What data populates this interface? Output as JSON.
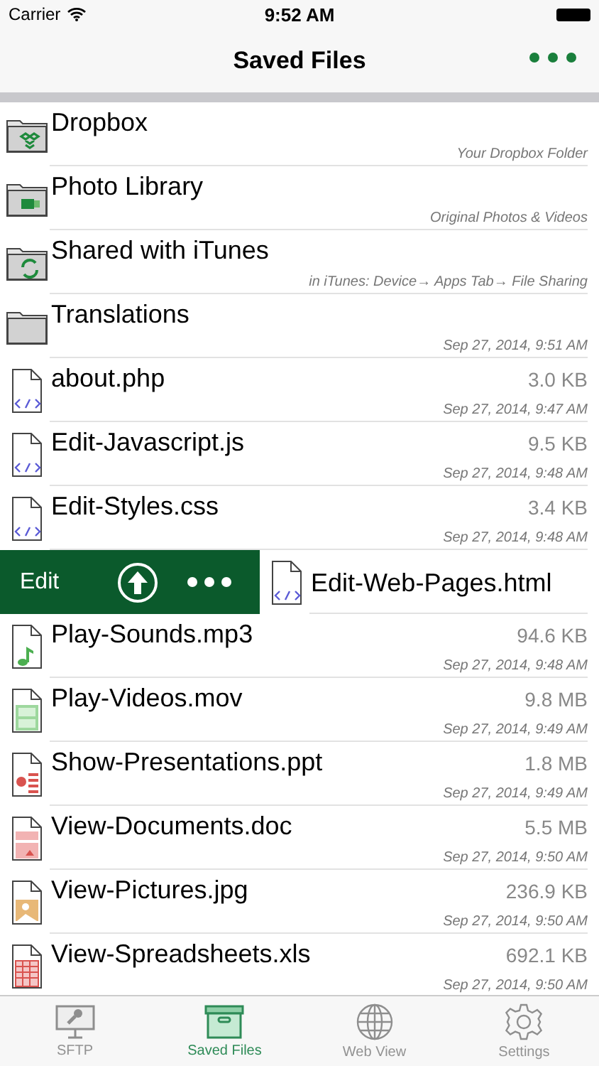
{
  "status_bar": {
    "carrier": "Carrier",
    "time": "9:52 AM"
  },
  "nav": {
    "title": "Saved Files"
  },
  "rows": [
    {
      "kind": "dropbox",
      "name": "Dropbox",
      "subtitle": "Your Dropbox Folder"
    },
    {
      "kind": "photo",
      "name": "Photo Library",
      "subtitle": "Original Photos & Videos"
    },
    {
      "kind": "sync",
      "name": "Shared with iTunes",
      "subtitle": "in iTunes: Device→ Apps Tab→ File Sharing"
    },
    {
      "kind": "folder",
      "name": "Translations",
      "subtitle": "Sep 27, 2014, 9:51 AM"
    },
    {
      "kind": "php",
      "name": "about.php",
      "size": "3.0 KB",
      "date": "Sep 27, 2014, 9:47 AM"
    },
    {
      "kind": "js",
      "name": "Edit-Javascript.js",
      "size": "9.5 KB",
      "date": "Sep 27, 2014, 9:48 AM"
    },
    {
      "kind": "css",
      "name": "Edit-Styles.css",
      "size": "3.4 KB",
      "date": "Sep 27, 2014, 9:48 AM"
    },
    {
      "kind": "html",
      "name": "Edit-Web-Pages.html",
      "actions": [
        {
          "kind": "text",
          "label": "Edit"
        },
        {
          "kind": "upload"
        },
        {
          "kind": "more"
        }
      ]
    },
    {
      "kind": "audio",
      "name": "Play-Sounds.mp3",
      "size": "94.6 KB",
      "date": "Sep 27, 2014, 9:48 AM"
    },
    {
      "kind": "video",
      "name": "Play-Videos.mov",
      "size": "9.8 MB",
      "date": "Sep 27, 2014, 9:49 AM"
    },
    {
      "kind": "ppt",
      "name": "Show-Presentations.ppt",
      "size": "1.8 MB",
      "date": "Sep 27, 2014, 9:49 AM"
    },
    {
      "kind": "doc",
      "name": "View-Documents.doc",
      "size": "5.5 MB",
      "date": "Sep 27, 2014, 9:50 AM"
    },
    {
      "kind": "image",
      "name": "View-Pictures.jpg",
      "size": "236.9 KB",
      "date": "Sep 27, 2014, 9:50 AM"
    },
    {
      "kind": "xls",
      "name": "View-Spreadsheets.xls",
      "size": "692.1 KB",
      "date": "Sep 27, 2014, 9:50 AM"
    }
  ],
  "tabs": [
    {
      "label": "SFTP",
      "selected": false
    },
    {
      "label": "Saved Files",
      "selected": true
    },
    {
      "label": "Web View",
      "selected": false
    },
    {
      "label": "Settings",
      "selected": false
    }
  ]
}
